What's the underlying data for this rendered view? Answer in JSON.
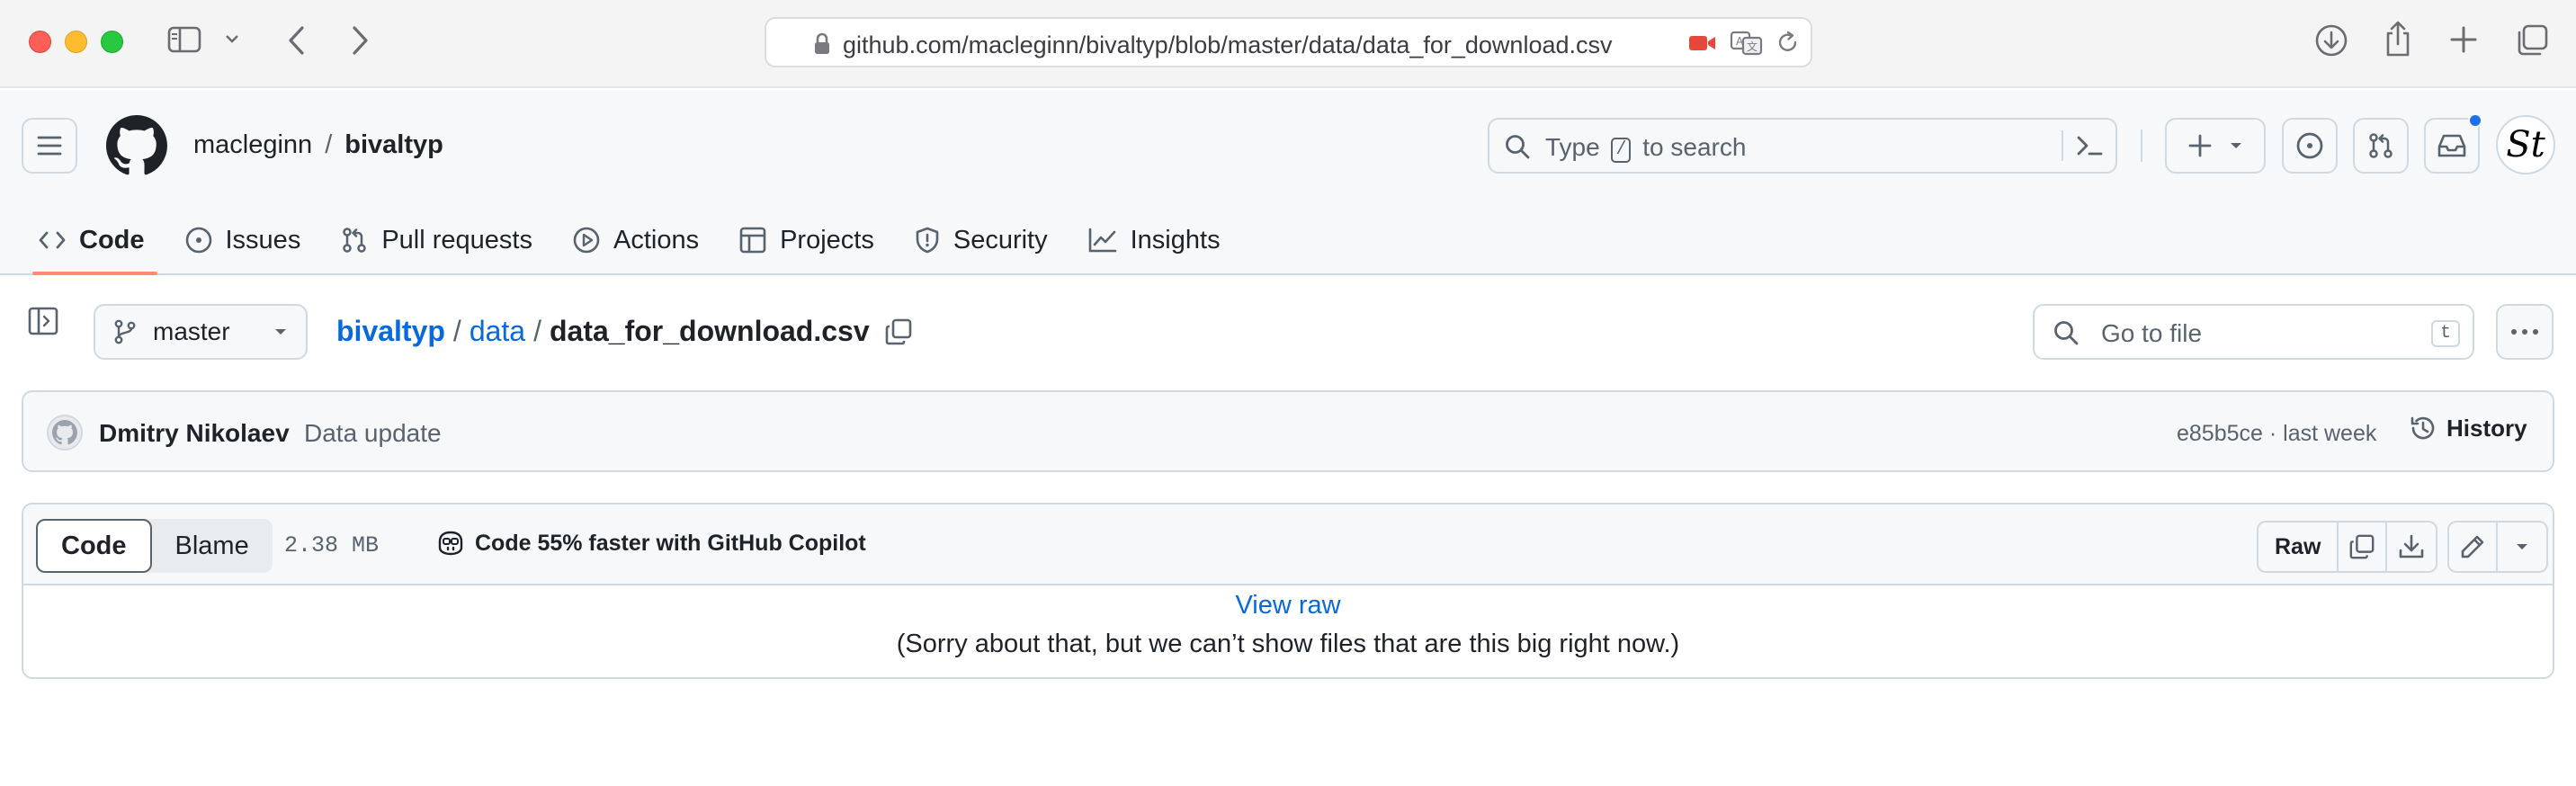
{
  "browser": {
    "url": "github.com/macleginn/bivaltyp/blob/master/data/data_for_download.csv",
    "icons": [
      "sidebar-icon",
      "chevron-down-icon",
      "back-icon",
      "forward-icon",
      "lock-icon",
      "camera-recording-icon",
      "translate-icon",
      "reload-icon",
      "downloads-icon",
      "share-icon",
      "new-tab-icon",
      "tab-overview-icon"
    ],
    "colors": {
      "close": "#ff5f57",
      "minimize": "#febc2e",
      "zoom": "#28c840"
    }
  },
  "header": {
    "owner": "macleginn",
    "separator": "/",
    "repo": "bivaltyp",
    "search": {
      "prefix": "Type",
      "key": "/",
      "suffix": "to search"
    },
    "icons": [
      "menu-icon",
      "github-logo-icon",
      "search-icon",
      "command-palette-icon",
      "plus-icon",
      "issue-opened-icon",
      "pull-request-icon",
      "inbox-icon"
    ],
    "avatar_text": "St",
    "notification_color": "#1f6feb"
  },
  "tabs": [
    {
      "label": "Code",
      "icon": "code-icon",
      "selected": true
    },
    {
      "label": "Issues",
      "icon": "issue-icon",
      "selected": false
    },
    {
      "label": "Pull requests",
      "icon": "pull-request-icon",
      "selected": false
    },
    {
      "label": "Actions",
      "icon": "play-icon",
      "selected": false
    },
    {
      "label": "Projects",
      "icon": "table-icon",
      "selected": false
    },
    {
      "label": "Security",
      "icon": "shield-icon",
      "selected": false
    },
    {
      "label": "Insights",
      "icon": "graph-icon",
      "selected": false
    }
  ],
  "file_nav": {
    "branch": "master",
    "breadcrumb": {
      "repo": "bivaltyp",
      "folder": "data",
      "separator": "/",
      "file": "data_for_download.csv"
    },
    "goto_placeholder": "Go to file",
    "goto_key": "t"
  },
  "commit": {
    "author": "Dmitry Nikolaev",
    "message": "Data update",
    "meta": "e85b5ce · last week",
    "history_label": "History"
  },
  "viewer": {
    "tab_code": "Code",
    "tab_blame": "Blame",
    "size": "2.38 MB",
    "copilot_text": "Code 55% faster with GitHub Copilot",
    "raw_label": "Raw",
    "view_raw": "View raw",
    "too_big_message": "(Sorry about that, but we can’t show files that are this big right now.)"
  },
  "colors": {
    "link": "#0969da",
    "tab_underline": "#fd8c73",
    "border": "#d1d9e0",
    "muted": "#59636e"
  }
}
